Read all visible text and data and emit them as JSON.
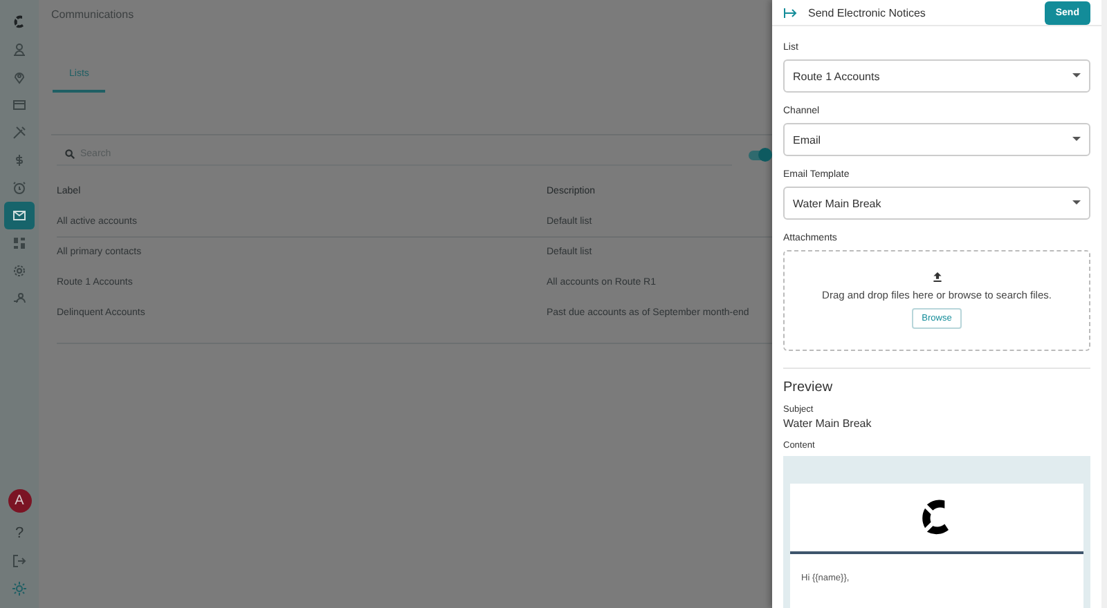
{
  "sidebar": {
    "items": [
      {
        "selected": false
      },
      {
        "selected": false
      },
      {
        "selected": false
      },
      {
        "selected": false
      },
      {
        "selected": false
      },
      {
        "selected": false
      },
      {
        "selected": true
      },
      {
        "selected": false
      },
      {
        "selected": false
      },
      {
        "selected": false
      }
    ],
    "avatar": "A",
    "help": "?"
  },
  "page": {
    "title": "Communications",
    "tabs": [
      {
        "label": "Lists",
        "selected": true
      }
    ],
    "search": {
      "placeholder": "Search"
    },
    "toggle": {
      "on": true
    },
    "table": {
      "columns": [
        "Label",
        "Description"
      ],
      "rows": [
        [
          "All active accounts",
          "Default list"
        ],
        [
          "All primary contacts",
          "Default list"
        ],
        [
          "Route 1 Accounts",
          "All accounts on Route R1"
        ],
        [
          "Delinquent Accounts",
          "Past due accounts as of September month-end"
        ]
      ]
    }
  },
  "drawer": {
    "title": "Send Electronic Notices",
    "send": "Send",
    "fields": [
      {
        "label": "List",
        "value": "Route 1 Accounts"
      },
      {
        "label": "Channel",
        "value": "Email"
      },
      {
        "label": "Email Template",
        "value": "Water Main Break"
      }
    ],
    "attachments": {
      "label": "Attachments",
      "hint": "Drag and drop files here or browse to search files.",
      "button": "Browse"
    },
    "preview": {
      "title": "Preview",
      "subject_label": "Subject",
      "subject": "Water Main Break",
      "content_label": "Content",
      "greeting": "Hi {{name}},"
    }
  }
}
